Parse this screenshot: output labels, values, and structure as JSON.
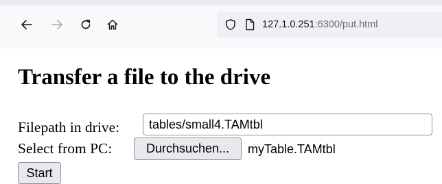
{
  "browser": {
    "url_host": "127.1.0.251",
    "url_rest": ":6300/put.html",
    "icons": {
      "back": "arrow-left-icon",
      "forward": "arrow-right-icon",
      "reload": "reload-icon",
      "home": "home-icon",
      "tracking": "shield-icon",
      "page": "page-icon"
    }
  },
  "page": {
    "title": "Transfer a file to the drive",
    "filepath_label": "Filepath in drive:",
    "filepath_value": "tables/small4.TAMtbl",
    "select_label": "Select from PC:",
    "browse_label": "Durchsuchen...",
    "chosen_file": "myTable.TAMtbl",
    "start_label": "Start"
  }
}
